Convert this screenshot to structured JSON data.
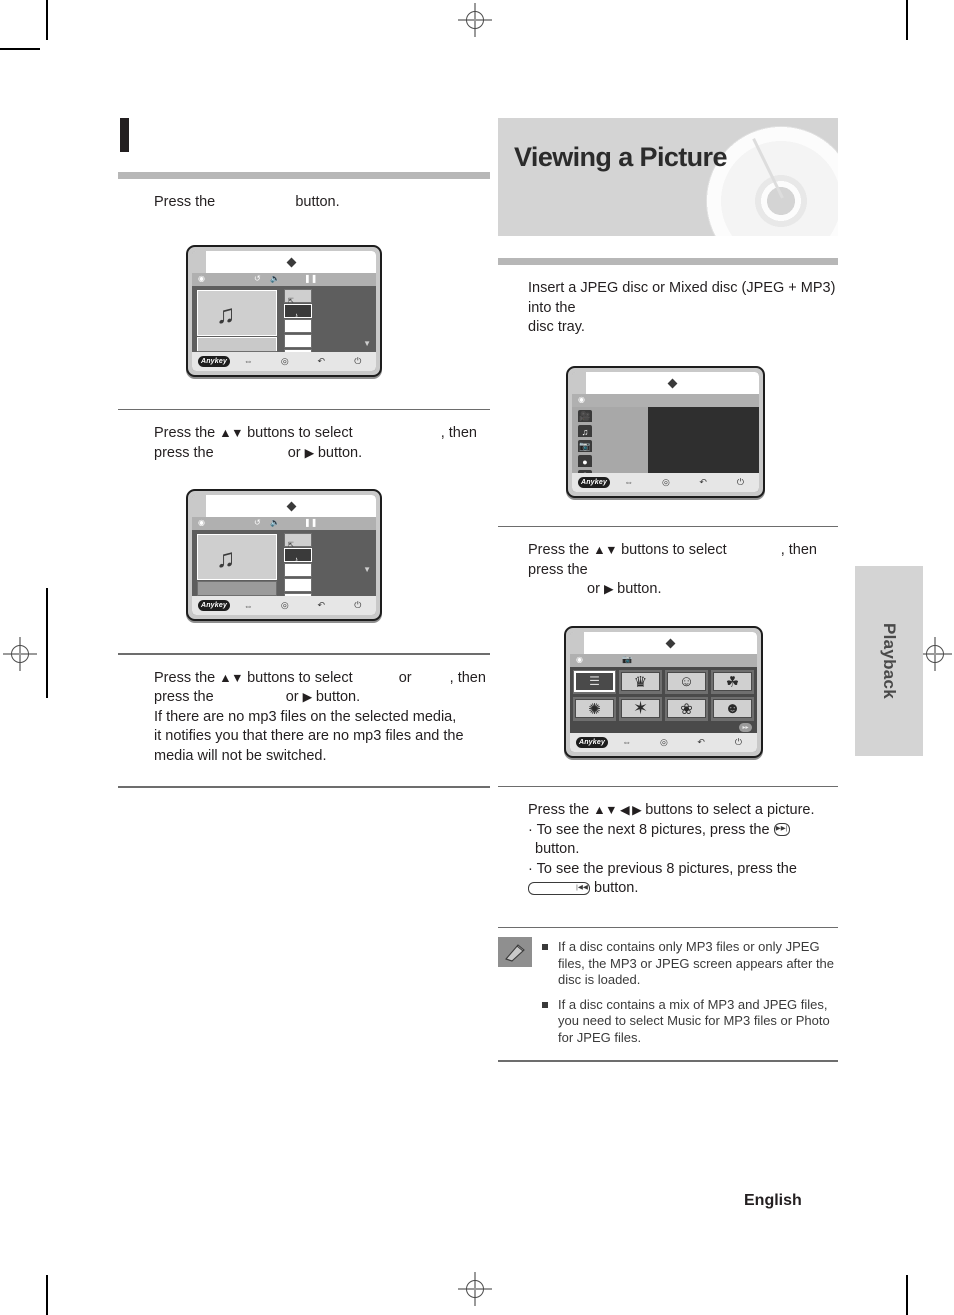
{
  "page": {
    "language_footer": "English",
    "side_tab": "Playback"
  },
  "left_column": {
    "heading_blank": "",
    "steps": [
      {
        "id": "step-1",
        "line1_a": "Press the",
        "line1_blank": "",
        "line1_b": "button."
      },
      {
        "id": "step-2",
        "line1_a": "Press the",
        "arrows": "▲▼",
        "line1_b": "buttons to select",
        "line1_blank": "",
        "line1_c": ", then",
        "line2_a": "press the",
        "line2_blank": "",
        "line2_b": "or",
        "line2_arrow": "▶",
        "line2_c": "button."
      },
      {
        "id": "step-3",
        "line1_a": "Press the",
        "arrows": "▲▼",
        "line1_b": "buttons to select",
        "line1_blank1": "",
        "line1_or": "or",
        "line1_blank2": "",
        "line1_c": ", then",
        "line2_a": "press the",
        "line2_blank": "",
        "line2_b": "or",
        "line2_arrow": "▶",
        "line2_c": "button.",
        "line3": "If there are no mp3 files on the selected media,",
        "line4": "it notifies you that there are no mp3 files and the",
        "line5": "media will not be switched."
      }
    ],
    "screens": [
      {
        "name": "mp3-player-screen-1",
        "toolbar_icons": [
          "disc-icon",
          "repeat-icon",
          "volume-icon",
          "pause-icon"
        ],
        "album_art": "music-note-art",
        "list_rows": [
          "",
          "",
          "",
          "",
          ""
        ],
        "file_items": [
          "folder-up-icon",
          "music-note-icon",
          "",
          "",
          "",
          ""
        ],
        "footer_label": "Anykey",
        "footer_icons": [
          "navigate-icon",
          "enter-icon",
          "return-icon",
          "exit-icon"
        ]
      },
      {
        "name": "mp3-player-screen-2",
        "toolbar_icons": [
          "disc-icon",
          "repeat-icon",
          "volume-icon",
          "pause-icon"
        ],
        "album_art": "music-note-art",
        "list_rows": [
          "",
          "",
          "",
          "",
          ""
        ],
        "file_items": [
          "folder-up-icon",
          "music-note-icon",
          "",
          "",
          "",
          ""
        ],
        "overlay_check": "✓",
        "footer_label": "Anykey",
        "footer_icons": [
          "navigate-icon",
          "enter-icon",
          "return-icon",
          "exit-icon"
        ]
      }
    ]
  },
  "right_column": {
    "section_title": "Viewing a Picture",
    "steps": [
      {
        "id": "step-1",
        "line1": "Insert a JPEG disc or Mixed disc (JPEG + MP3) into the",
        "line2": "disc tray."
      },
      {
        "id": "step-2",
        "line1_a": "Press the",
        "arrows": "▲▼",
        "line1_b": "buttons to select",
        "line1_blank": "",
        "line1_c": ", then press the",
        "line2_blank": "",
        "line2_b": "or",
        "line2_arrow": "▶",
        "line2_c": "button."
      },
      {
        "id": "step-3",
        "line1_a": "Press the",
        "arrows": "▲▼ ◀ ▶",
        "line1_b": "buttons to select a picture.",
        "bullet1_a": "· To see the next 8 pictures, press the",
        "bullet1_icon": "next-skip-icon",
        "bullet1_b": "button.",
        "bullet2_a": "· To see the previous 8 pictures, press the",
        "bullet2_icon": "prev-skip-icon",
        "bullet2_b": "button."
      }
    ],
    "screens": [
      {
        "name": "disc-menu-screen",
        "toolbar_icons": [
          "disc-icon"
        ],
        "menu_items": [
          "film-icon",
          "music-icon",
          "photo-icon",
          "disc-icon",
          "setup-icon"
        ],
        "footer_label": "Anykey",
        "footer_icons": [
          "navigate-icon",
          "enter-icon",
          "return-icon",
          "exit-icon"
        ]
      },
      {
        "name": "photo-thumbnail-screen",
        "toolbar_icons": [
          "disc-icon",
          "photo-icon"
        ],
        "thumbnails": [
          {
            "label": "selected-list-thumb",
            "glyph": "☰",
            "selected": true
          },
          {
            "label": "castle-thumb",
            "glyph": "🏰",
            "selected": false
          },
          {
            "label": "girl-thumb",
            "glyph": "👧",
            "selected": false
          },
          {
            "label": "tree-thumb",
            "glyph": "🌳",
            "selected": false
          },
          {
            "label": "bird-thumb",
            "glyph": "🐦",
            "selected": false
          },
          {
            "label": "sun-thumb",
            "glyph": "☀",
            "selected": false
          },
          {
            "label": "flower-thumb",
            "glyph": "🌿",
            "selected": false
          },
          {
            "label": "girl-flowers-thumb",
            "glyph": "👩",
            "selected": false
          }
        ],
        "next_mark": "▸▸",
        "footer_label": "Anykey",
        "footer_icons": [
          "navigate-icon",
          "enter-icon",
          "return-icon",
          "exit-icon"
        ]
      }
    ],
    "note": {
      "icon": "pencil-note-icon",
      "items": [
        "If a disc contains only MP3 files or only JPEG files, the MP3 or JPEG screen appears after the disc is loaded.",
        "If a disc contains a mix of MP3 and JPEG files, you need to select Music for MP3 files or Photo for JPEG files."
      ]
    }
  }
}
